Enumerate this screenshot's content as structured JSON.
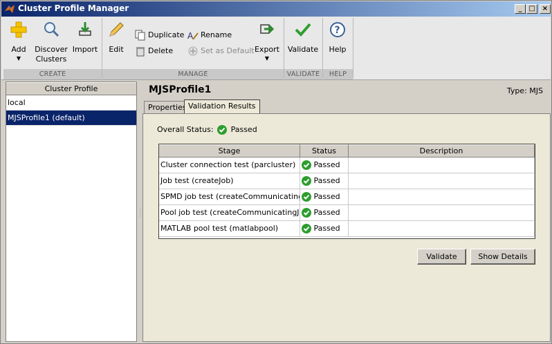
{
  "window": {
    "title": "Cluster Profile Manager"
  },
  "toolstrip": {
    "add_label": "Add",
    "discover_label": "Discover",
    "discover_label2": "Clusters",
    "import_label": "Import",
    "edit_label": "Edit",
    "duplicate_label": "Duplicate",
    "delete_label": "Delete",
    "rename_label": "Rename",
    "set_default_label": "Set as Default",
    "export_label": "Export",
    "validate_label": "Validate",
    "help_label": "Help",
    "sections": {
      "create": "CREATE",
      "manage": "MANAGE",
      "validate": "VALIDATE",
      "help": "HELP"
    }
  },
  "sidebar": {
    "header": "Cluster Profile",
    "items": [
      {
        "label": "local"
      },
      {
        "label": "MJSProfile1 (default)"
      }
    ]
  },
  "main": {
    "profile_name": "MJSProfile1",
    "profile_type": "Type: MJS",
    "tabs": [
      {
        "label": "Properties"
      },
      {
        "label": "Validation Results"
      }
    ],
    "overall_status_label": "Overall Status:",
    "overall_status_value": "Passed",
    "table": {
      "columns": [
        "Stage",
        "Status",
        "Description"
      ],
      "rows": [
        {
          "stage": "Cluster connection test (parcluster)",
          "status": "Passed",
          "description": ""
        },
        {
          "stage": "Job test (createJob)",
          "status": "Passed",
          "description": ""
        },
        {
          "stage": "SPMD job test (createCommunicatingJob)",
          "status": "Passed",
          "description": ""
        },
        {
          "stage": "Pool job test (createCommunicatingJob)",
          "status": "Passed",
          "description": ""
        },
        {
          "stage": "MATLAB pool test (matlabpool)",
          "status": "Passed",
          "description": ""
        }
      ]
    },
    "validate_button": "Validate",
    "show_details_button": "Show Details"
  },
  "colors": {
    "selection": "#0a246a",
    "pass_green": "#2e9d2e",
    "titlebar": "#0a246a"
  }
}
